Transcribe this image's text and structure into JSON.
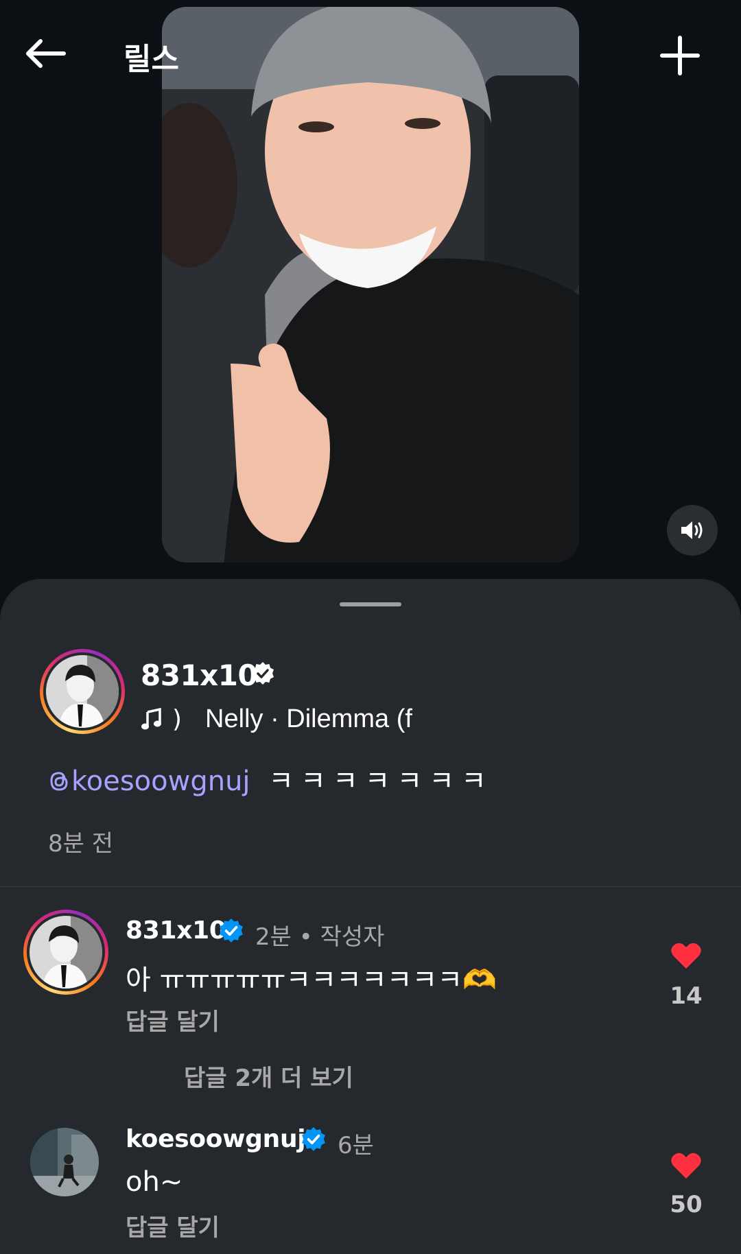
{
  "header": {
    "title": "릴스"
  },
  "post": {
    "username": "831x10",
    "music_paren": ")",
    "music_title": "Nelly · Dilemma (f",
    "mention": "koesoowgnuj",
    "caption_text": "ㅋㅋㅋㅋㅋㅋㅋ",
    "time": "8분 전"
  },
  "comments": [
    {
      "username": "831x10",
      "time": "2분",
      "author_tag": "• 작성자",
      "text": "아 ㅠㅠㅠㅠㅠㅋㅋㅋㅋㅋㅋㅋ🫶",
      "reply": "답글 달기",
      "likes": "14",
      "more_replies": "답글 2개 더 보기"
    },
    {
      "username": "koesoowgnuj",
      "time": "6분",
      "text": "oh~",
      "reply": "답글 달기",
      "likes": "50"
    }
  ],
  "colors": {
    "background": "#0c1014",
    "sheet": "#25292e",
    "mention": "#a6a2ff",
    "verified": "#0095f6",
    "like": "#ff3040"
  },
  "icons": [
    "back-arrow-icon",
    "plus-icon",
    "speaker-icon",
    "verified-icon",
    "music-note-icon",
    "threads-icon",
    "heart-icon"
  ]
}
